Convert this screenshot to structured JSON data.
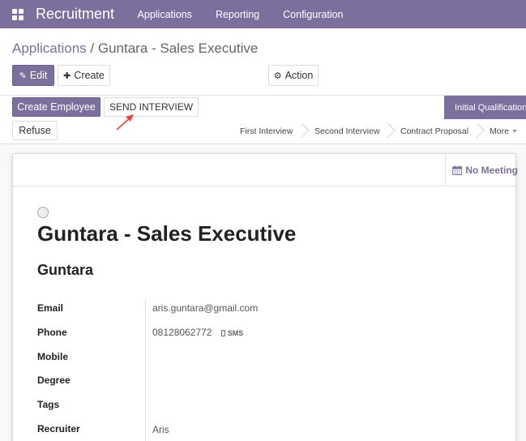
{
  "navbar": {
    "brand": "Recruitment",
    "items": [
      "Applications",
      "Reporting",
      "Configuration"
    ]
  },
  "breadcrumb": {
    "parent": "Applications",
    "separator": " / ",
    "current": "Guntara - Sales Executive"
  },
  "toolbar": {
    "edit_label": "Edit",
    "create_label": "Create",
    "action_label": "Action"
  },
  "header_buttons": {
    "create_employee_label": "Create Employee",
    "send_interview_label": "SEND INTERVIEW",
    "refuse_label": "Refuse"
  },
  "stages": {
    "active": "Initial Qualification",
    "items": [
      "First Interview",
      "Second Interview",
      "Contract Proposal"
    ],
    "more_label": "More"
  },
  "smart_button": {
    "meeting_label": "No Meeting"
  },
  "record": {
    "title": "Guntara - Sales Executive",
    "applicant_name": "Guntara",
    "fields": {
      "email": {
        "label": "Email",
        "value": "aris.guntara@gmail.com"
      },
      "phone": {
        "label": "Phone",
        "value": "08128062772",
        "sms_label": "SMS"
      },
      "mobile": {
        "label": "Mobile",
        "value": ""
      },
      "degree": {
        "label": "Degree",
        "value": ""
      },
      "tags": {
        "label": "Tags",
        "value": ""
      },
      "recruiter": {
        "label": "Recruiter",
        "value": "Aris"
      }
    }
  },
  "colors": {
    "brand": "#7c6f9e",
    "annotation_arrow": "#e8453c"
  }
}
